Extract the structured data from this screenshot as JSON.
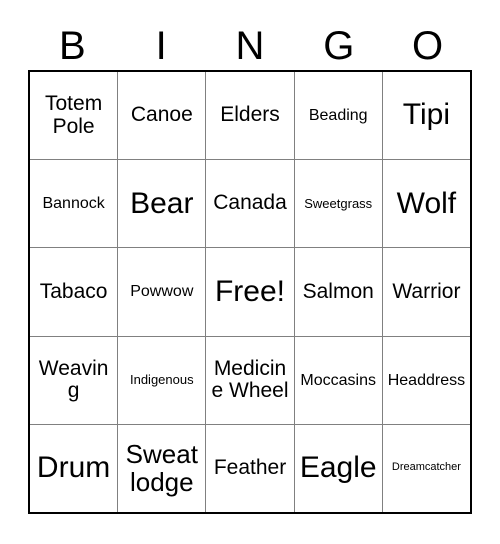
{
  "card": {
    "header_letters": [
      "B",
      "I",
      "N",
      "G",
      "O"
    ],
    "colors": {
      "text": "#000000",
      "outer_border": "#000000",
      "inner_border": "#808080",
      "background": "#ffffff"
    },
    "rows": [
      [
        {
          "text": "Totem Pole",
          "size": "md"
        },
        {
          "text": "Canoe",
          "size": "md"
        },
        {
          "text": "Elders",
          "size": "md"
        },
        {
          "text": "Beading",
          "size": "sm"
        },
        {
          "text": "Tipi",
          "size": "xl"
        }
      ],
      [
        {
          "text": "Bannock",
          "size": "sm"
        },
        {
          "text": "Bear",
          "size": "xl"
        },
        {
          "text": "Canada",
          "size": "md"
        },
        {
          "text": "Sweetgrass",
          "size": "xs"
        },
        {
          "text": "Wolf",
          "size": "xl"
        }
      ],
      [
        {
          "text": "Tabaco",
          "size": "md"
        },
        {
          "text": "Powwow",
          "size": "sm"
        },
        {
          "text": "Free!",
          "size": "xl"
        },
        {
          "text": "Salmon",
          "size": "md"
        },
        {
          "text": "Warrior",
          "size": "md"
        }
      ],
      [
        {
          "text": "Weaving",
          "size": "md"
        },
        {
          "text": "Indigenous",
          "size": "xs"
        },
        {
          "text": "Medicine Wheel",
          "size": "md"
        },
        {
          "text": "Moccasins",
          "size": "sm"
        },
        {
          "text": "Headdress",
          "size": "sm"
        }
      ],
      [
        {
          "text": "Drum",
          "size": "xl"
        },
        {
          "text": "Sweat lodge",
          "size": "lg"
        },
        {
          "text": "Feather",
          "size": "md"
        },
        {
          "text": "Eagle",
          "size": "xl"
        },
        {
          "text": "Dreamcatcher",
          "size": "xxs"
        }
      ]
    ]
  }
}
